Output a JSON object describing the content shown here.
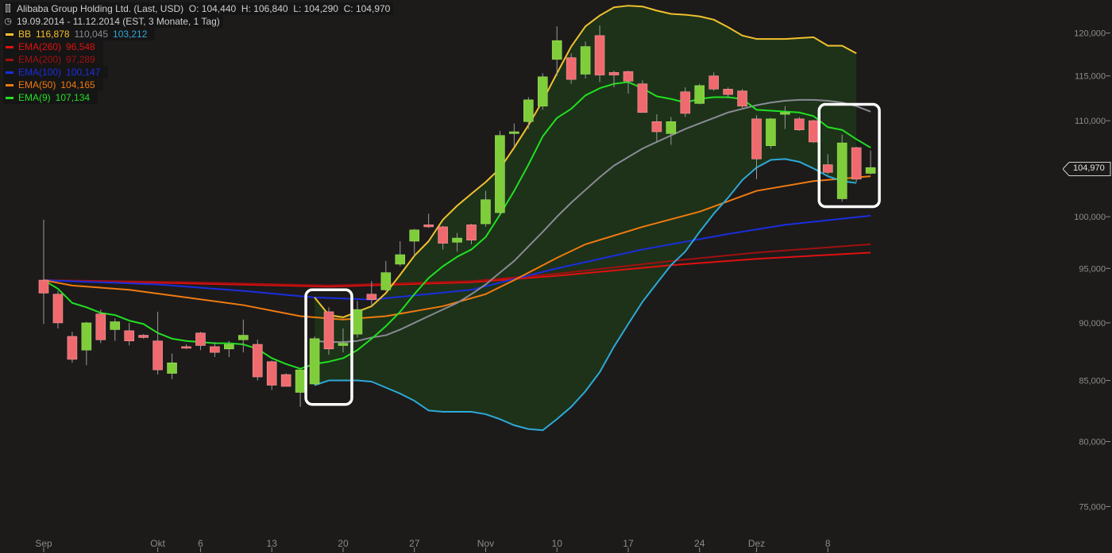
{
  "header": {
    "title": "Alibaba Group Holding Ltd. (Last, USD)",
    "open": "O: 104,440",
    "high": "H: 106,840",
    "low": "L: 104,290",
    "close": "C: 104,970",
    "period": "19.09.2014 - 11.12.2014 (EST, 3 Monate, 1 Tag)"
  },
  "indicators": [
    {
      "label": "BB",
      "color": "#f2c12e",
      "values": [
        "116,878",
        "110,045",
        "103,212"
      ],
      "value_colors": [
        "#f2c12e",
        "#8a8a94",
        "#2ea8d6"
      ]
    },
    {
      "label": "EMA(260)",
      "color": "#e01010",
      "values": [
        "96,548"
      ],
      "value_colors": [
        "#e01010"
      ]
    },
    {
      "label": "EMA(200)",
      "color": "#a01010",
      "values": [
        "97,289"
      ],
      "value_colors": [
        "#a01010"
      ]
    },
    {
      "label": "EMA(100)",
      "color": "#1a2ee0",
      "values": [
        "100,147"
      ],
      "value_colors": [
        "#1a2ee0"
      ]
    },
    {
      "label": "EMA(50)",
      "color": "#f07a10",
      "values": [
        "104,165"
      ],
      "value_colors": [
        "#f07a10"
      ]
    },
    {
      "label": "EMA(9)",
      "color": "#22e022",
      "values": [
        "107,134"
      ],
      "value_colors": [
        "#22e022"
      ]
    }
  ],
  "last_price": "104,970",
  "chart_data": {
    "type": "candlestick",
    "y_scale": "log",
    "ylim": [
      72.7,
      124.0
    ],
    "y_ticks": [
      {
        "value": 75,
        "label": "75,000"
      },
      {
        "value": 80,
        "label": "80,000"
      },
      {
        "value": 85,
        "label": "85,000"
      },
      {
        "value": 90,
        "label": "90,000"
      },
      {
        "value": 95,
        "label": "95,000"
      },
      {
        "value": 100,
        "label": "100,000"
      },
      {
        "value": 105,
        "label": "105,000"
      },
      {
        "value": 110,
        "label": "110,000"
      },
      {
        "value": 115,
        "label": "115,000"
      },
      {
        "value": 120,
        "label": "120,000"
      }
    ],
    "x_ticks": [
      {
        "label": "Sep",
        "index": 0
      },
      {
        "label": "Okt",
        "index": 8
      },
      {
        "label": "6",
        "index": 11
      },
      {
        "label": "13",
        "index": 16
      },
      {
        "label": "20",
        "index": 21
      },
      {
        "label": "27",
        "index": 26
      },
      {
        "label": "Nov",
        "index": 31
      },
      {
        "label": "10",
        "index": 36
      },
      {
        "label": "17",
        "index": 41
      },
      {
        "label": "24",
        "index": 46
      },
      {
        "label": "Dez",
        "index": 50
      },
      {
        "label": "8",
        "index": 55
      }
    ],
    "candles": [
      {
        "o": 93.9,
        "h": 99.7,
        "l": 89.9,
        "c": 92.7
      },
      {
        "o": 92.6,
        "h": 92.9,
        "l": 89.5,
        "c": 90.0
      },
      {
        "o": 88.8,
        "h": 89.2,
        "l": 86.5,
        "c": 86.8
      },
      {
        "o": 87.6,
        "h": 90.1,
        "l": 86.3,
        "c": 90.0
      },
      {
        "o": 90.8,
        "h": 91.2,
        "l": 88.2,
        "c": 88.5
      },
      {
        "o": 89.4,
        "h": 90.4,
        "l": 88.4,
        "c": 90.1
      },
      {
        "o": 89.3,
        "h": 90.0,
        "l": 88.0,
        "c": 88.4
      },
      {
        "o": 88.9,
        "h": 89.0,
        "l": 88.6,
        "c": 88.7
      },
      {
        "o": 88.4,
        "h": 91.0,
        "l": 85.5,
        "c": 85.9
      },
      {
        "o": 85.6,
        "h": 87.3,
        "l": 85.1,
        "c": 86.5
      },
      {
        "o": 87.9,
        "h": 88.1,
        "l": 87.7,
        "c": 87.8
      },
      {
        "o": 89.1,
        "h": 89.2,
        "l": 87.6,
        "c": 88.0
      },
      {
        "o": 87.9,
        "h": 88.3,
        "l": 87.0,
        "c": 87.4
      },
      {
        "o": 87.7,
        "h": 88.4,
        "l": 87.0,
        "c": 88.1
      },
      {
        "o": 88.5,
        "h": 90.3,
        "l": 87.4,
        "c": 88.9
      },
      {
        "o": 88.1,
        "h": 88.5,
        "l": 85.0,
        "c": 85.3
      },
      {
        "o": 86.6,
        "h": 86.7,
        "l": 84.2,
        "c": 84.6
      },
      {
        "o": 85.5,
        "h": 85.6,
        "l": 84.6,
        "c": 84.5
      },
      {
        "o": 84.0,
        "h": 85.9,
        "l": 82.8,
        "c": 85.9
      },
      {
        "o": 84.7,
        "h": 88.8,
        "l": 84.6,
        "c": 88.6
      },
      {
        "o": 91.0,
        "h": 91.4,
        "l": 87.2,
        "c": 87.7
      },
      {
        "o": 88.0,
        "h": 89.5,
        "l": 87.4,
        "c": 88.2
      },
      {
        "o": 89.0,
        "h": 92.0,
        "l": 88.7,
        "c": 91.2
      },
      {
        "o": 92.6,
        "h": 93.8,
        "l": 91.5,
        "c": 92.1
      },
      {
        "o": 93.0,
        "h": 95.7,
        "l": 92.9,
        "c": 94.6
      },
      {
        "o": 95.4,
        "h": 97.6,
        "l": 95.2,
        "c": 96.3
      },
      {
        "o": 97.6,
        "h": 98.8,
        "l": 96.2,
        "c": 98.7
      },
      {
        "o": 99.2,
        "h": 100.3,
        "l": 98.9,
        "c": 99.0
      },
      {
        "o": 99.0,
        "h": 99.1,
        "l": 96.8,
        "c": 97.4
      },
      {
        "o": 97.5,
        "h": 98.4,
        "l": 96.6,
        "c": 97.9
      },
      {
        "o": 99.2,
        "h": 99.3,
        "l": 97.3,
        "c": 97.7
      },
      {
        "o": 99.3,
        "h": 102.6,
        "l": 99.0,
        "c": 101.7
      },
      {
        "o": 100.4,
        "h": 108.9,
        "l": 100.1,
        "c": 108.4
      },
      {
        "o": 108.6,
        "h": 109.7,
        "l": 107.3,
        "c": 108.8
      },
      {
        "o": 109.9,
        "h": 112.6,
        "l": 109.1,
        "c": 112.3
      },
      {
        "o": 111.6,
        "h": 115.3,
        "l": 111.2,
        "c": 114.9
      },
      {
        "o": 116.9,
        "h": 120.8,
        "l": 115.0,
        "c": 119.1
      },
      {
        "o": 117.1,
        "h": 117.6,
        "l": 114.1,
        "c": 114.6
      },
      {
        "o": 115.2,
        "h": 119.0,
        "l": 114.7,
        "c": 118.4
      },
      {
        "o": 119.7,
        "h": 120.9,
        "l": 114.3,
        "c": 115.1
      },
      {
        "o": 115.4,
        "h": 115.6,
        "l": 113.7,
        "c": 115.1
      },
      {
        "o": 115.5,
        "h": 115.6,
        "l": 113.0,
        "c": 114.4
      },
      {
        "o": 114.1,
        "h": 114.5,
        "l": 111.0,
        "c": 110.9
      },
      {
        "o": 109.9,
        "h": 110.7,
        "l": 107.8,
        "c": 108.8
      },
      {
        "o": 108.6,
        "h": 110.4,
        "l": 107.4,
        "c": 109.9
      },
      {
        "o": 113.2,
        "h": 113.7,
        "l": 110.4,
        "c": 110.8
      },
      {
        "o": 111.9,
        "h": 114.1,
        "l": 111.8,
        "c": 113.9
      },
      {
        "o": 115.0,
        "h": 115.4,
        "l": 113.3,
        "c": 113.5
      },
      {
        "o": 113.5,
        "h": 113.7,
        "l": 112.5,
        "c": 112.9
      },
      {
        "o": 113.3,
        "h": 113.5,
        "l": 111.4,
        "c": 111.6
      },
      {
        "o": 110.2,
        "h": 110.6,
        "l": 103.8,
        "c": 105.9
      },
      {
        "o": 107.3,
        "h": 110.3,
        "l": 107.0,
        "c": 110.2
      },
      {
        "o": 110.7,
        "h": 111.6,
        "l": 109.1,
        "c": 110.9
      },
      {
        "o": 110.2,
        "h": 110.4,
        "l": 108.9,
        "c": 109.0
      },
      {
        "o": 110.0,
        "h": 110.1,
        "l": 107.6,
        "c": 107.7
      },
      {
        "o": 105.3,
        "h": 106.4,
        "l": 104.3,
        "c": 104.5
      },
      {
        "o": 101.8,
        "h": 108.5,
        "l": 101.5,
        "c": 107.6
      },
      {
        "o": 107.1,
        "h": 107.2,
        "l": 103.5,
        "c": 103.8
      },
      {
        "o": 104.4,
        "h": 106.8,
        "l": 104.3,
        "c": 105.0
      }
    ],
    "series": [
      {
        "key": "bb_upper",
        "color": "#f2c12e",
        "start": 19,
        "values": [
          92.3,
          90.7,
          90.5,
          91.0,
          91.5,
          92.7,
          94.4,
          96.2,
          97.6,
          99.7,
          101.1,
          102.3,
          103.5,
          104.9,
          107.1,
          109.5,
          112.2,
          115.3,
          118.4,
          120.8,
          122.1,
          123.1,
          123.3,
          123.2,
          122.7,
          122.3,
          122.2,
          122.0,
          121.6,
          120.7,
          119.7,
          119.3,
          119.3,
          119.3,
          119.4,
          119.5,
          118.5,
          118.5,
          117.6
        ]
      },
      {
        "key": "bb_middle",
        "color": "#8a8a94",
        "start": 19,
        "values": null,
        "points": [
          [
            19,
            88.4
          ],
          [
            20,
            88.3
          ],
          [
            21,
            88.3
          ],
          [
            22,
            88.4
          ],
          [
            23,
            88.7
          ],
          [
            24,
            88.9
          ],
          [
            25,
            89.4
          ],
          [
            26,
            90.0
          ],
          [
            27,
            90.6
          ],
          [
            28,
            91.2
          ],
          [
            29,
            91.8
          ],
          [
            30,
            92.6
          ],
          [
            31,
            93.5
          ],
          [
            32,
            94.6
          ],
          [
            33,
            95.7
          ],
          [
            34,
            97.1
          ],
          [
            35,
            98.5
          ],
          [
            36,
            100.0
          ],
          [
            37,
            101.4
          ],
          [
            38,
            102.7
          ],
          [
            39,
            104.0
          ],
          [
            40,
            105.2
          ],
          [
            41,
            106.1
          ],
          [
            42,
            107.0
          ],
          [
            43,
            107.7
          ],
          [
            44,
            108.4
          ],
          [
            45,
            109.1
          ],
          [
            46,
            109.7
          ],
          [
            47,
            110.3
          ],
          [
            48,
            110.9
          ],
          [
            49,
            111.3
          ],
          [
            50,
            111.7
          ],
          [
            51,
            112.0
          ],
          [
            52,
            112.2
          ],
          [
            53,
            112.3
          ],
          [
            54,
            112.3
          ],
          [
            55,
            112.2
          ],
          [
            56,
            112.0
          ],
          [
            57,
            111.6
          ],
          [
            58,
            111.0
          ]
        ]
      },
      {
        "key": "bb_lower",
        "color": "#2ea8d6",
        "start": 19,
        "values": [
          84.6,
          85.0,
          85.0,
          85.0,
          84.9,
          84.4,
          83.9,
          83.3,
          82.5,
          82.4,
          82.4,
          82.4,
          82.2,
          81.8,
          81.3,
          81.0,
          80.9,
          81.8,
          82.8,
          84.1,
          85.7,
          87.9,
          89.9,
          91.9,
          93.6,
          95.3,
          96.6,
          98.5,
          100.3,
          101.9,
          103.7,
          105.0,
          105.8,
          105.9,
          105.6,
          104.9,
          104.1,
          103.6,
          103.4
        ]
      },
      {
        "key": "ema260",
        "color": "#e01010",
        "start": 0,
        "points": [
          [
            0,
            93.9
          ],
          [
            10,
            93.6
          ],
          [
            20,
            93.3
          ],
          [
            30,
            93.7
          ],
          [
            36,
            94.3
          ],
          [
            44,
            95.3
          ],
          [
            50,
            95.9
          ],
          [
            58,
            96.5
          ]
        ]
      },
      {
        "key": "ema200",
        "color": "#a01010",
        "start": 0,
        "points": [
          [
            0,
            93.9
          ],
          [
            10,
            93.7
          ],
          [
            20,
            93.4
          ],
          [
            30,
            93.8
          ],
          [
            36,
            94.5
          ],
          [
            44,
            95.7
          ],
          [
            50,
            96.5
          ],
          [
            58,
            97.3
          ]
        ]
      },
      {
        "key": "ema100",
        "color": "#1a2ee0",
        "start": 0,
        "points": [
          [
            0,
            93.9
          ],
          [
            8,
            93.5
          ],
          [
            14,
            92.9
          ],
          [
            19,
            92.3
          ],
          [
            23,
            92.1
          ],
          [
            30,
            93.0
          ],
          [
            36,
            95.0
          ],
          [
            42,
            96.8
          ],
          [
            48,
            98.3
          ],
          [
            52,
            99.2
          ],
          [
            58,
            100.1
          ]
        ]
      },
      {
        "key": "ema50",
        "color": "#f07a10",
        "start": 0,
        "points": [
          [
            0,
            93.9
          ],
          [
            2,
            93.4
          ],
          [
            6,
            93.0
          ],
          [
            10,
            92.3
          ],
          [
            14,
            91.6
          ],
          [
            18,
            90.6
          ],
          [
            21,
            90.3
          ],
          [
            24,
            90.6
          ],
          [
            28,
            91.5
          ],
          [
            31,
            92.6
          ],
          [
            33,
            93.9
          ],
          [
            36,
            96.0
          ],
          [
            38,
            97.3
          ],
          [
            42,
            99.0
          ],
          [
            46,
            100.5
          ],
          [
            50,
            102.6
          ],
          [
            54,
            103.6
          ],
          [
            58,
            104.1
          ]
        ]
      },
      {
        "key": "ema9",
        "color": "#22e022",
        "start": 0,
        "points": [
          [
            0,
            93.9
          ],
          [
            1,
            93.1
          ],
          [
            2,
            91.8
          ],
          [
            3,
            91.4
          ],
          [
            4,
            90.9
          ],
          [
            5,
            90.7
          ],
          [
            6,
            90.2
          ],
          [
            7,
            89.9
          ],
          [
            8,
            89.1
          ],
          [
            9,
            88.6
          ],
          [
            10,
            88.4
          ],
          [
            11,
            88.3
          ],
          [
            12,
            88.2
          ],
          [
            13,
            88.2
          ],
          [
            14,
            88.1
          ],
          [
            15,
            87.7
          ],
          [
            16,
            86.9
          ],
          [
            17,
            86.4
          ],
          [
            18,
            86.0
          ],
          [
            19,
            86.4
          ],
          [
            20,
            86.6
          ],
          [
            21,
            86.9
          ],
          [
            22,
            87.6
          ],
          [
            23,
            88.6
          ],
          [
            24,
            89.7
          ],
          [
            25,
            91.0
          ],
          [
            26,
            92.6
          ],
          [
            27,
            94.1
          ],
          [
            28,
            95.2
          ],
          [
            29,
            96.1
          ],
          [
            30,
            96.8
          ],
          [
            31,
            98.0
          ],
          [
            32,
            100.2
          ],
          [
            33,
            102.6
          ],
          [
            34,
            105.3
          ],
          [
            35,
            108.3
          ],
          [
            36,
            110.3
          ],
          [
            37,
            111.3
          ],
          [
            38,
            112.8
          ],
          [
            39,
            113.6
          ],
          [
            40,
            114.1
          ],
          [
            41,
            114.3
          ],
          [
            42,
            113.6
          ],
          [
            43,
            112.7
          ],
          [
            44,
            112.4
          ],
          [
            45,
            112.0
          ],
          [
            46,
            112.4
          ],
          [
            47,
            112.6
          ],
          [
            48,
            112.6
          ],
          [
            49,
            112.4
          ],
          [
            50,
            111.2
          ],
          [
            51,
            111.1
          ],
          [
            52,
            111.0
          ],
          [
            53,
            110.9
          ],
          [
            54,
            110.5
          ],
          [
            55,
            109.3
          ],
          [
            56,
            109.0
          ],
          [
            57,
            108.0
          ],
          [
            58,
            107.1
          ]
        ]
      }
    ],
    "highlight_boxes": [
      {
        "from_index": 19,
        "to_index": 21,
        "y_top": 93.0,
        "y_bottom": 83.0
      },
      {
        "from_index": 55,
        "to_index": 58,
        "y_top": 111.8,
        "y_bottom": 101.0
      }
    ]
  }
}
